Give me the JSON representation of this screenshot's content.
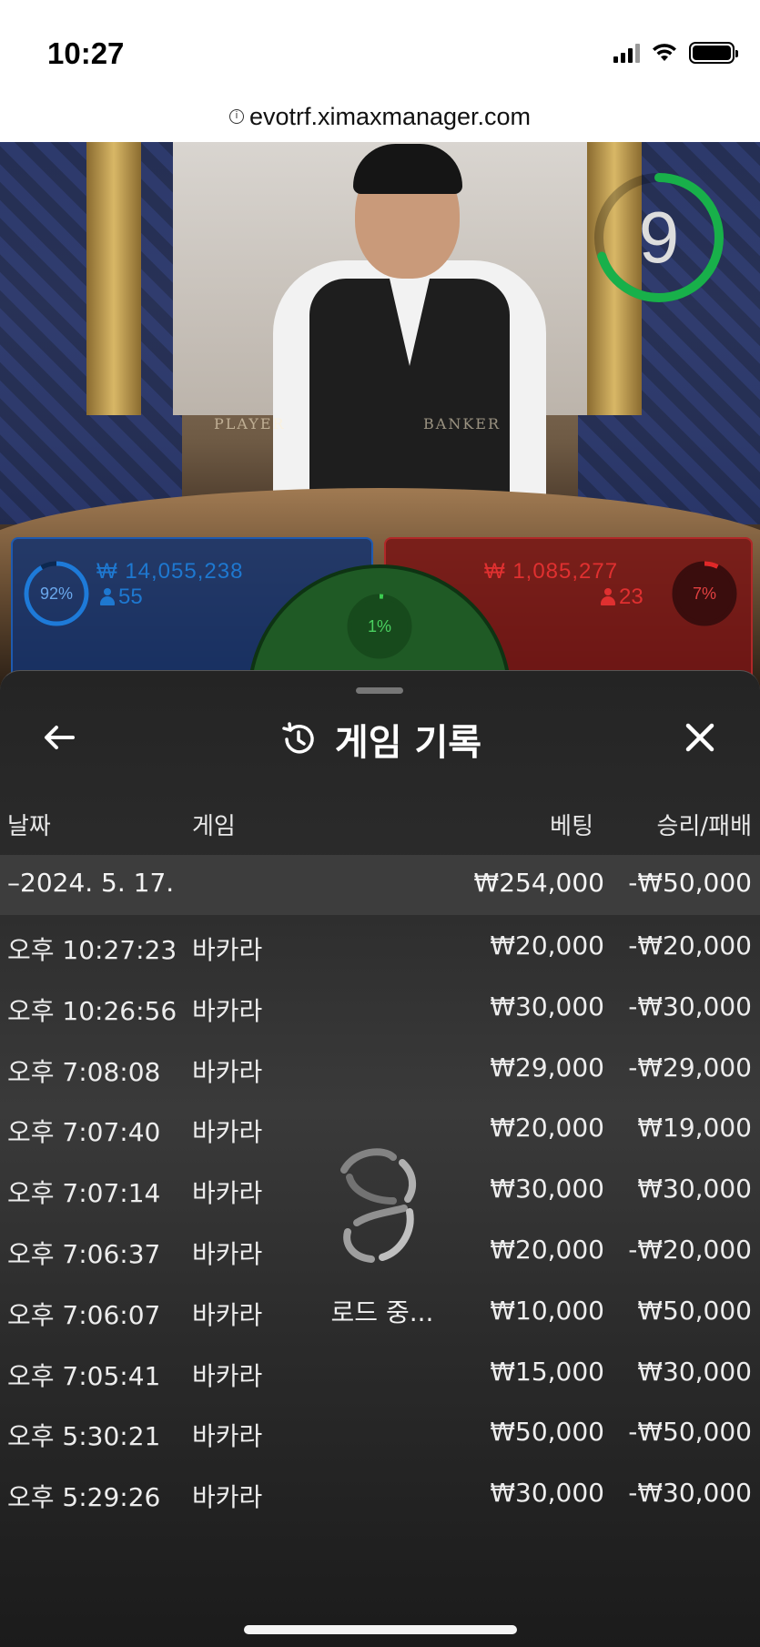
{
  "status_bar": {
    "time": "10:27"
  },
  "browser": {
    "url": "evotrf.ximaxmanager.com",
    "info_icon": "info-icon"
  },
  "video": {
    "countdown": "9",
    "table_labels": {
      "player": "PLAYER",
      "banker": "BANKER"
    },
    "player_bet": {
      "percent": "92%",
      "amount": "₩ 14,055,238",
      "players": "55",
      "color": "#1e6fc0"
    },
    "banker_bet": {
      "percent": "7%",
      "amount": "₩ 1,085,277",
      "players": "23",
      "color": "#d02424"
    },
    "tie_bet": {
      "percent": "1%",
      "color": "#2a8a34"
    }
  },
  "sheet": {
    "title": "게임 기록",
    "back_icon": "arrow-left-icon",
    "history_icon": "history-icon",
    "close_icon": "close-icon",
    "columns": {
      "date": "날짜",
      "game": "게임",
      "bet": "베팅",
      "result": "승리/패배"
    },
    "date_group": {
      "date": "–2024. 5. 17.",
      "bet": "₩254,000",
      "result": "-₩50,000"
    },
    "rows": [
      {
        "time": "오후 10:27:23",
        "game": "바카라",
        "bet": "₩20,000",
        "result": "-₩20,000"
      },
      {
        "time": "오후 10:26:56",
        "game": "바카라",
        "bet": "₩30,000",
        "result": "-₩30,000"
      },
      {
        "time": "오후 7:08:08",
        "game": "바카라",
        "bet": "₩29,000",
        "result": "-₩29,000"
      },
      {
        "time": "오후 7:07:40",
        "game": "바카라",
        "bet": "₩20,000",
        "result": "₩19,000"
      },
      {
        "time": "오후 7:07:14",
        "game": "바카라",
        "bet": "₩30,000",
        "result": "₩30,000"
      },
      {
        "time": "오후 7:06:37",
        "game": "바카라",
        "bet": "₩20,000",
        "result": "-₩20,000"
      },
      {
        "time": "오후 7:06:07",
        "game": "바카라",
        "bet": "₩10,000",
        "result": "₩50,000"
      },
      {
        "time": "오후 7:05:41",
        "game": "바카라",
        "bet": "₩15,000",
        "result": "₩30,000"
      },
      {
        "time": "오후 5:30:21",
        "game": "바카라",
        "bet": "₩50,000",
        "result": "-₩50,000"
      },
      {
        "time": "오후 5:29:26",
        "game": "바카라",
        "bet": "₩30,000",
        "result": "-₩30,000"
      }
    ],
    "loading_text": "로드 중..."
  }
}
